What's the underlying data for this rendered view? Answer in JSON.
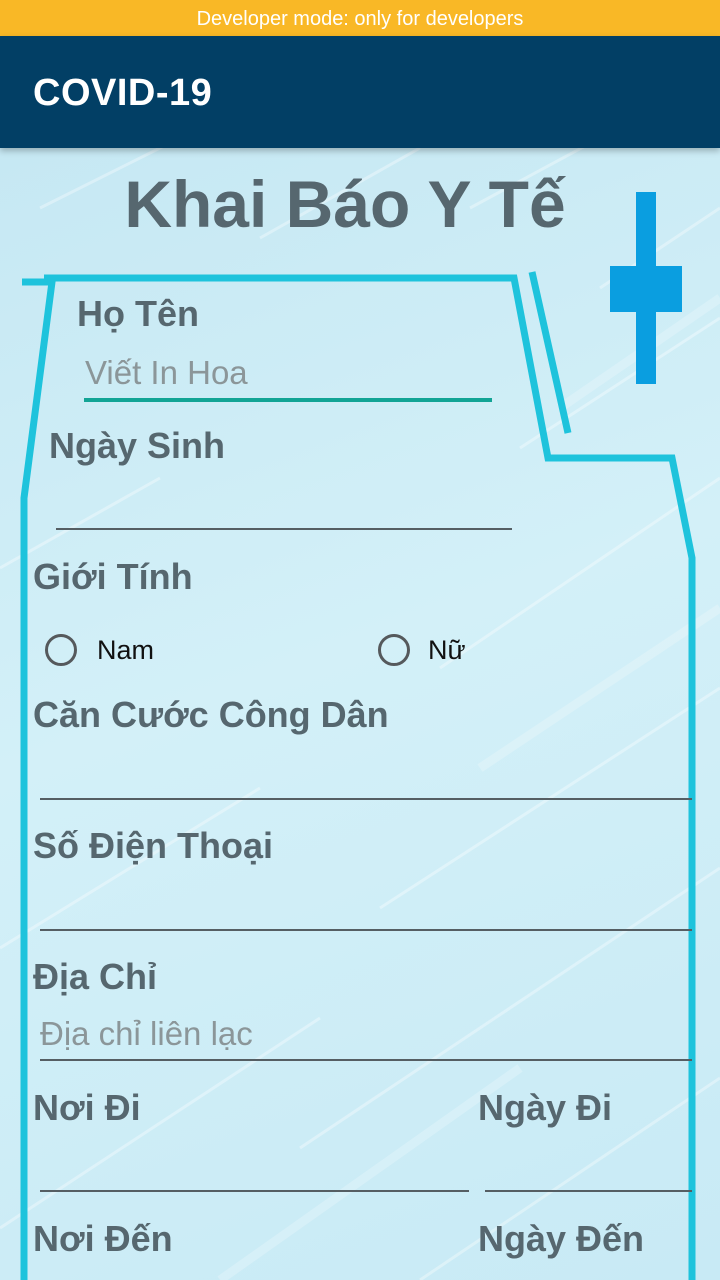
{
  "status_banner": "Developer mode: only for developers",
  "app_bar": {
    "title": "COVID-19"
  },
  "form": {
    "title": "Khai Báo Y Tế",
    "full_name": {
      "label": "Họ Tên",
      "placeholder": "Viết In Hoa",
      "value": ""
    },
    "birth_date": {
      "label": "Ngày Sinh",
      "value": ""
    },
    "gender": {
      "label": "Giới Tính",
      "options": [
        "Nam",
        "Nữ"
      ],
      "selected": null
    },
    "citizen_id": {
      "label": "Căn Cước Công Dân",
      "value": ""
    },
    "phone": {
      "label": "Số Điện Thoại",
      "value": ""
    },
    "address": {
      "label": "Địa Chỉ",
      "placeholder": "Địa chỉ liên lạc",
      "value": ""
    },
    "departure_place": {
      "label": "Nơi Đi",
      "value": ""
    },
    "departure_date": {
      "label": "Ngày Đi",
      "value": ""
    },
    "destination": {
      "label": "Nơi Đến",
      "value": ""
    },
    "arrival_date": {
      "label": "Ngày Đến",
      "value": ""
    }
  },
  "colors": {
    "status_banner": "#f9b826",
    "app_bar": "#023f65",
    "active_underline": "#12a495",
    "frame_stroke": "#1ec3dc",
    "medical_cross": "#0a9ee0"
  },
  "icons": [
    "medical-cross-icon"
  ]
}
